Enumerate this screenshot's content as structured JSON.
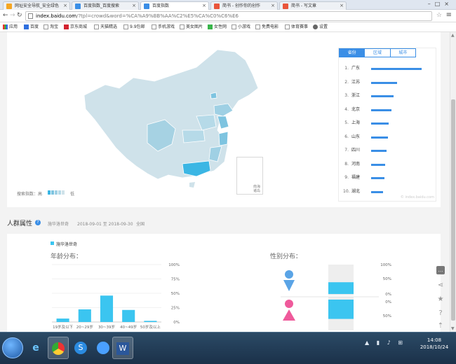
{
  "browser": {
    "tabs": [
      {
        "title": "网址安全导航_安全绿色",
        "color": "#f5a623"
      },
      {
        "title": "百度指数_百度搜索",
        "color": "#3a8ee6"
      },
      {
        "title": "百度指数",
        "color": "#3a8ee6"
      },
      {
        "title": "简书 - 创作你的创作",
        "color": "#e9553b"
      },
      {
        "title": "简书 - 写文章",
        "color": "#e9553b"
      }
    ],
    "url_host": "index.baidu.com",
    "url_path": "/?tpl=crowd&word=%CA%A9%BB%AA%C2%E5%CA%C0%C6%E6",
    "bookmarks": [
      "应用",
      "百度",
      "淘宝",
      "京东商城",
      "天猫精选",
      "9.9包邮",
      "手机游戏",
      "美女图片",
      "女性网",
      "小游戏",
      "免费电影",
      "体育赛事",
      "设置"
    ]
  },
  "region": {
    "tabs": [
      "省份",
      "区域",
      "城市"
    ],
    "active_tab": 0,
    "ranking": [
      {
        "rank": "1.",
        "name": "广东",
        "value": 100
      },
      {
        "rank": "2.",
        "name": "江苏",
        "value": 52
      },
      {
        "rank": "3.",
        "name": "浙江",
        "value": 44
      },
      {
        "rank": "4.",
        "name": "北京",
        "value": 40
      },
      {
        "rank": "5.",
        "name": "上海",
        "value": 35
      },
      {
        "rank": "6.",
        "name": "山东",
        "value": 33
      },
      {
        "rank": "7.",
        "name": "四川",
        "value": 31
      },
      {
        "rank": "8.",
        "name": "河南",
        "value": 28
      },
      {
        "rank": "9.",
        "name": "福建",
        "value": 27
      },
      {
        "rank": "10.",
        "name": "湖北",
        "value": 23
      }
    ],
    "footer": "© index.baidu.com",
    "legend_high": "搜索指数：高",
    "legend_low": "低",
    "island_label": "南海诸岛"
  },
  "crowd": {
    "title": "人群属性",
    "keyword": "施华洛世奇",
    "date_range": "2018-09-01 至 2018-09-30",
    "scope": "全国",
    "legend": "施华洛世奇"
  },
  "chart_data": [
    {
      "type": "bar",
      "title": "年龄分布：",
      "categories": [
        "19岁及以下",
        "20~29岁",
        "30~39岁",
        "40~49岁",
        "50岁及以上"
      ],
      "values": [
        6,
        22,
        46,
        21,
        2
      ],
      "ylim": [
        0,
        100
      ],
      "yticks": [
        "100%",
        "75%",
        "50%",
        "25%",
        "0%"
      ],
      "color": "#3bc5f0"
    },
    {
      "type": "bar",
      "title": "性别分布：",
      "categories": [
        "男",
        "女"
      ],
      "values": [
        40,
        60
      ],
      "yticks_top": [
        "100%",
        "50%",
        "0%"
      ],
      "yticks_bottom": [
        "0%",
        "50%"
      ],
      "male_color": "#5aa4e6",
      "female_color": "#ef5a9b",
      "bar_color": "#3bc5f0"
    }
  ],
  "taskbar": {
    "time": "14:08",
    "date": "2018/10/24"
  }
}
